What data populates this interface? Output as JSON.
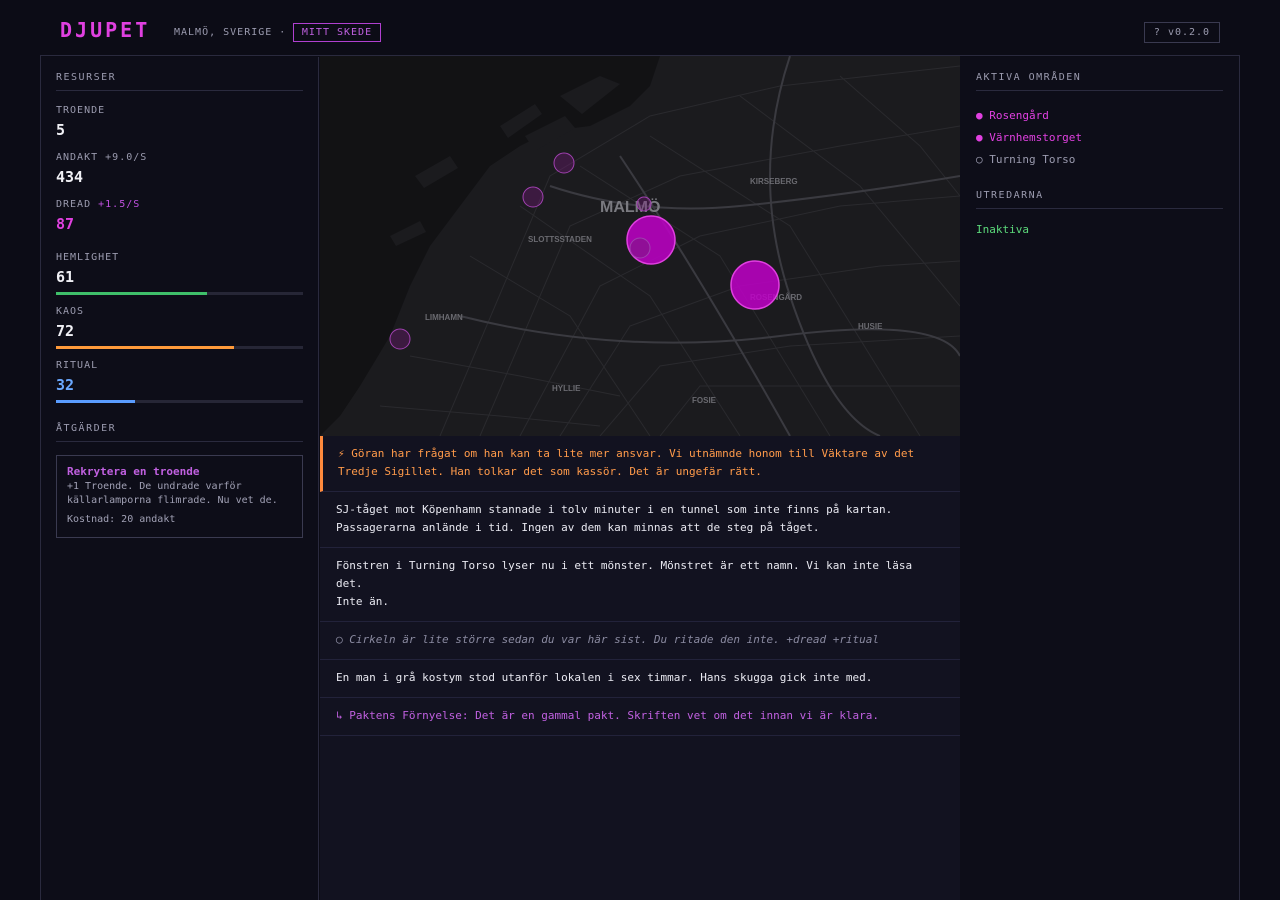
{
  "header": {
    "logo": "DJUPET",
    "location": "MALMÖ, SVERIGE ·",
    "mode_label": "MITT SKEDE",
    "version_label": "? v0.2.0"
  },
  "resources": {
    "title": "RESURSER",
    "followers": {
      "label": "TROENDE",
      "value": "5"
    },
    "devotion": {
      "label": "ANDAKT",
      "rate": "+9.0/S",
      "value": "434"
    },
    "dread": {
      "label": "DREAD",
      "rate": "+1.5/S",
      "value": "87"
    },
    "secrecy": {
      "label": "HEMLIGHET",
      "value": "61",
      "percent": 61,
      "color": "#3fbf6a"
    },
    "chaos": {
      "label": "KAOS",
      "value": "72",
      "percent": 72,
      "color": "#ff9a3a"
    },
    "ritual": {
      "label": "RITUAL",
      "value": "32",
      "percent": 32,
      "color": "#5a9cff"
    }
  },
  "actions": {
    "title": "ÅTGÄRDER",
    "recruit": {
      "title": "Rekrytera en troende",
      "desc_line1": "+1 Troende. De undrade varför",
      "desc_line2": "källarlamporna flimrade. Nu vet de.",
      "cost": "Kostnad: 20 andakt"
    }
  },
  "map": {
    "labels": {
      "malmo": "MALMÖ",
      "kirseberg": "KIRSEBERG",
      "slottsstaden": "SLOTTSSTADEN",
      "limhamn": "LIMHAMN",
      "husie": "HUSIE",
      "hyllie": "HYLLIE",
      "fosie": "FOSIE",
      "rosengard": "ROSENGÅRD"
    }
  },
  "feed": [
    {
      "type": "alert",
      "line1": "⚡ Göran har frågat om han kan ta lite mer ansvar. Vi utnämnde honom till Väktare av det",
      "line2": "Tredje Sigillet. Han tolkar det som kassör. Det är ungefär rätt."
    },
    {
      "type": "normal",
      "line1": "SJ-tåget mot Köpenhamn stannade i tolv minuter i en tunnel som inte finns på kartan.",
      "line2": "Passagerarna anlände i tid. Ingen av dem kan minnas att de steg på tåget."
    },
    {
      "type": "normal",
      "line1": "Fönstren i Turning Torso lyser nu i ett mönster. Mönstret är ett namn. Vi kan inte läsa det.",
      "line2": "Inte än."
    },
    {
      "type": "italic",
      "line1": "◯ Cirkeln är lite större sedan du var här sist. Du ritade den inte. +dread +ritual"
    },
    {
      "type": "normal",
      "line1": "En man i grå kostym stod utanför lokalen i sex timmar. Hans skugga gick inte med."
    },
    {
      "type": "ritual",
      "line1": "↳ Paktens Förnyelse: Det är en gammal pakt. Skriften vet om det innan vi är klara."
    }
  ],
  "areas": {
    "title": "AKTIVA OMRÅDEN",
    "items": [
      {
        "label": "● Rosengård",
        "state": "active"
      },
      {
        "label": "● Värnhemstorget",
        "state": "active"
      },
      {
        "label": "○ Turning Torso",
        "state": "inactive"
      }
    ]
  },
  "investigators": {
    "title": "UTREDARNA",
    "status": "Inaktiva"
  },
  "colors": {
    "accent": "#e040e0",
    "alert": "#ff9a4a",
    "ok": "#5bd87a"
  }
}
